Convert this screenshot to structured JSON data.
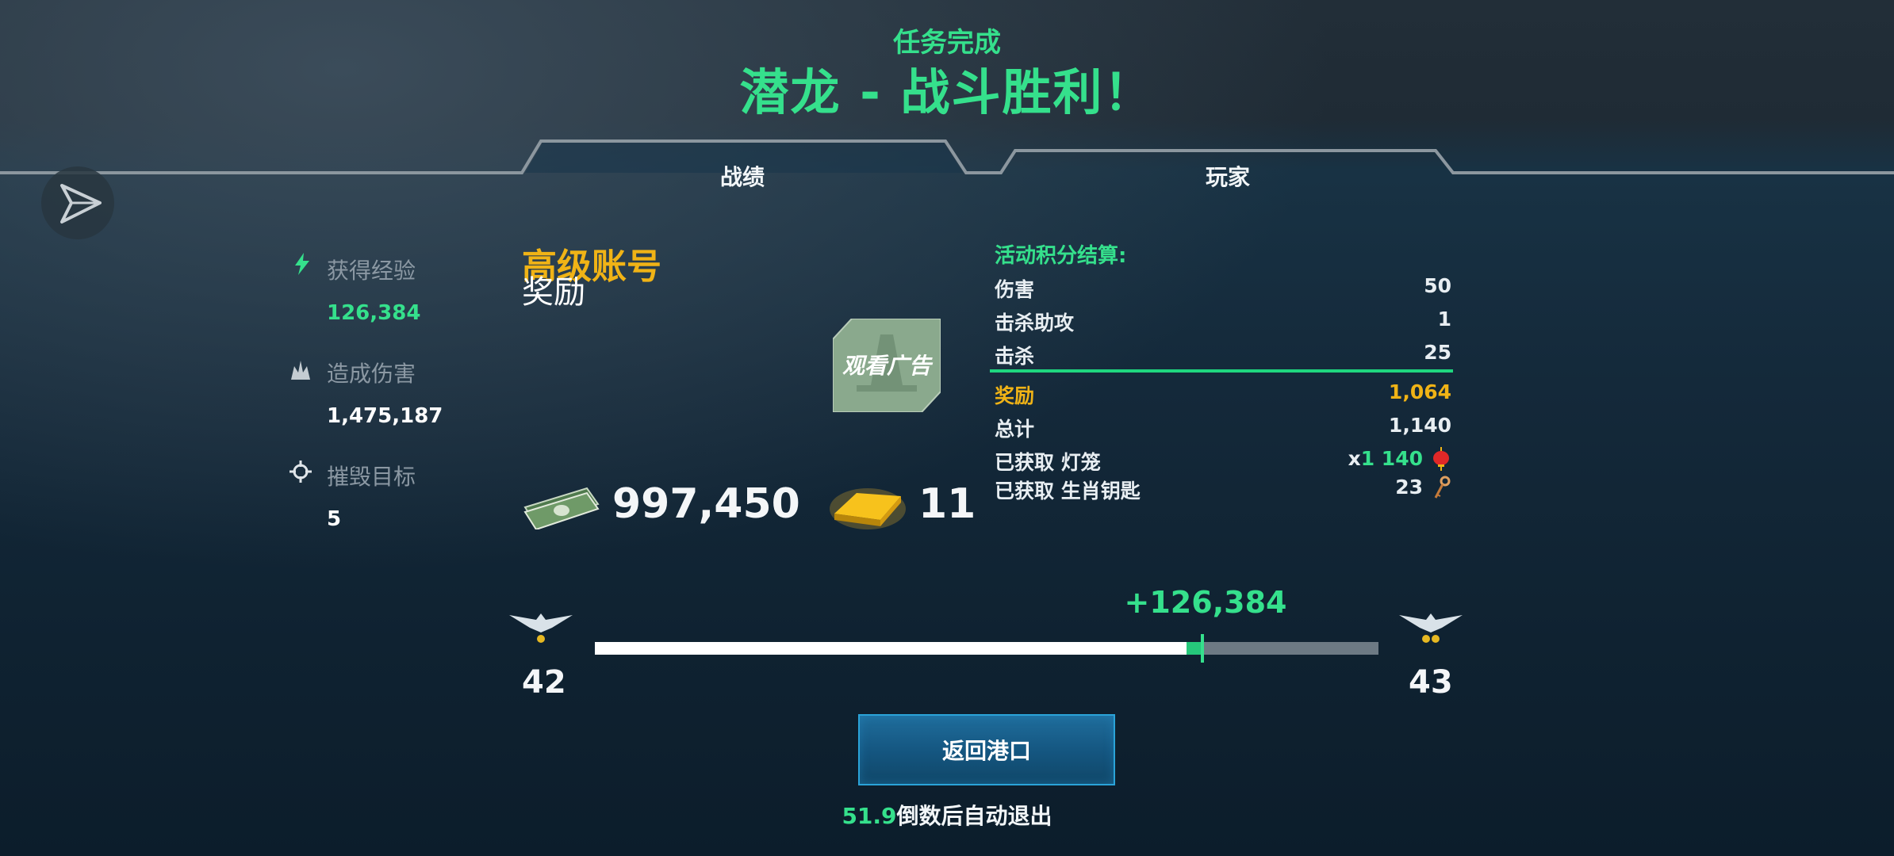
{
  "header": {
    "subtitle": "任务完成",
    "title": "潜龙 - 战斗胜利！"
  },
  "tabs": [
    {
      "label": "战绩",
      "active": true
    },
    {
      "label": "玩家",
      "active": false
    }
  ],
  "share_icon": "share-arrow-icon",
  "stats": [
    {
      "icon": "bolt-icon",
      "label": "获得经验",
      "value": "126,384",
      "value_color": "#35e08c"
    },
    {
      "icon": "explosion-icon",
      "label": "造成伤害",
      "value": "1,475,187",
      "value_color": "#ffffff"
    },
    {
      "icon": "crosshair-icon",
      "label": "摧毁目标",
      "value": "5",
      "value_color": "#ffffff"
    }
  ],
  "premium": {
    "title": "高级账号",
    "subtitle": "奖励"
  },
  "ad": {
    "label": "观看广告",
    "icon": "ship-icon"
  },
  "rewards": {
    "money": {
      "icon": "cash-icon",
      "value": "997,450"
    },
    "gold": {
      "icon": "gold-bar-icon",
      "value": "11"
    }
  },
  "points": {
    "title": "活动积分结算:",
    "rows": [
      {
        "label": "伤害",
        "value": "50"
      },
      {
        "label": "击杀助攻",
        "value": "1"
      },
      {
        "label": "击杀",
        "value": "25"
      }
    ],
    "bonus": {
      "label": "奖励",
      "value": "1,064"
    },
    "total": {
      "label": "总计",
      "value": "1,140"
    },
    "lantern": {
      "label": "已获取 灯笼",
      "prefix": "x",
      "value": "1 140",
      "icon": "lantern-icon"
    },
    "keys": {
      "label": "已获取 生肖钥匙",
      "value": "23",
      "icon": "key-icon"
    }
  },
  "progress": {
    "level_current": "42",
    "level_next": "43",
    "gain_text": "+126,384",
    "fill_before": 0.755,
    "fill_after": 0.775,
    "rank_icon": "eagle-rank-icon"
  },
  "colors": {
    "accent": "#35e08c",
    "gold": "#f0b316",
    "button": "#14557f"
  },
  "return_button": {
    "label": "返回港口"
  },
  "countdown": {
    "number": "51.9",
    "text": "倒数后自动退出"
  }
}
